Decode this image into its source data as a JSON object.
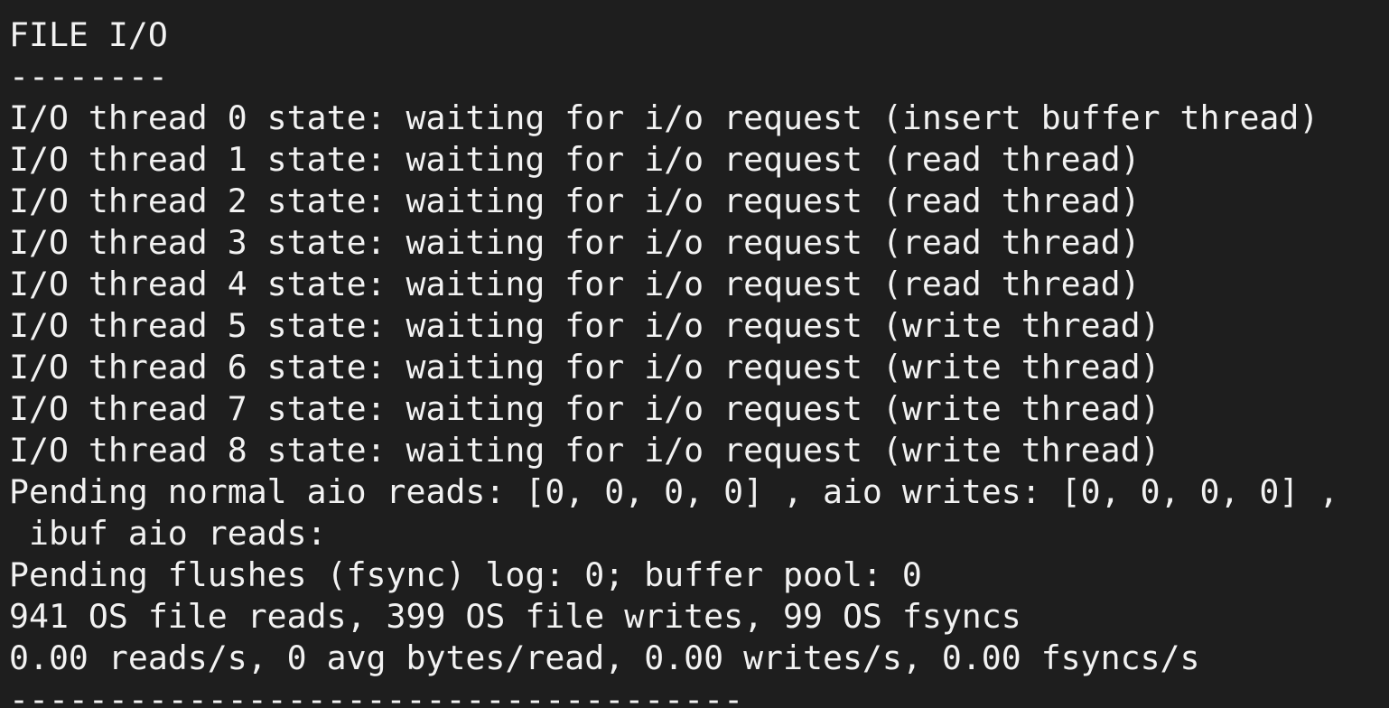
{
  "terminal": {
    "background": "#1e1e1e",
    "foreground": "#f2f2f2",
    "lines": [
      "FILE I/O",
      "--------",
      "I/O thread 0 state: waiting for i/o request (insert buffer thread)",
      "I/O thread 1 state: waiting for i/o request (read thread)",
      "I/O thread 2 state: waiting for i/o request (read thread)",
      "I/O thread 3 state: waiting for i/o request (read thread)",
      "I/O thread 4 state: waiting for i/o request (read thread)",
      "I/O thread 5 state: waiting for i/o request (write thread)",
      "I/O thread 6 state: waiting for i/o request (write thread)",
      "I/O thread 7 state: waiting for i/o request (write thread)",
      "I/O thread 8 state: waiting for i/o request (write thread)",
      "Pending normal aio reads: [0, 0, 0, 0] , aio writes: [0, 0, 0, 0] ,",
      " ibuf aio reads:",
      "Pending flushes (fsync) log: 0; buffer pool: 0",
      "941 OS file reads, 399 OS file writes, 99 OS fsyncs",
      "0.00 reads/s, 0 avg bytes/read, 0.00 writes/s, 0.00 fsyncs/s",
      "-------------------------------------"
    ]
  }
}
